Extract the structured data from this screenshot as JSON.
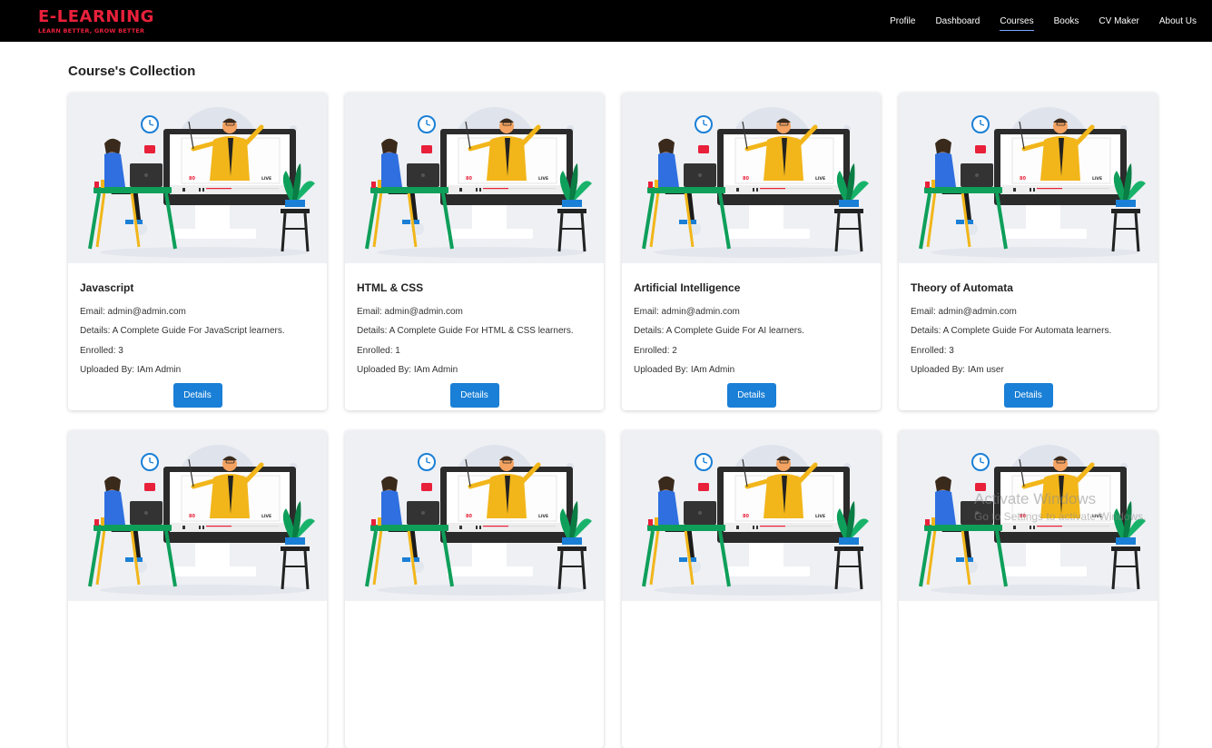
{
  "brand": {
    "title": "E-LEARNING",
    "tagline": "LEARN BETTER, GROW BETTER",
    "color": "#e8203a"
  },
  "nav": [
    {
      "label": "Profile",
      "active": false
    },
    {
      "label": "Dashboard",
      "active": false
    },
    {
      "label": "Courses",
      "active": true
    },
    {
      "label": "Books",
      "active": false
    },
    {
      "label": "CV Maker",
      "active": false
    },
    {
      "label": "About Us",
      "active": false
    }
  ],
  "page_title": "Course's Collection",
  "courses": [
    {
      "title": "Javascript",
      "email": "Email: admin@admin.com",
      "details": "Details: A Complete Guide For JavaScript learners.",
      "enrolled": "Enrolled: 3",
      "uploaded_by": "Uploaded By: IAm Admin",
      "button": "Details"
    },
    {
      "title": "HTML & CSS",
      "email": "Email: admin@admin.com",
      "details": "Details: A Complete Guide For HTML & CSS learners.",
      "enrolled": "Enrolled: 1",
      "uploaded_by": "Uploaded By: IAm Admin",
      "button": "Details"
    },
    {
      "title": "Artificial Intelligence",
      "email": "Email: admin@admin.com",
      "details": "Details: A Complete Guide For AI learners.",
      "enrolled": "Enrolled: 2",
      "uploaded_by": "Uploaded By: IAm Admin",
      "button": "Details"
    },
    {
      "title": "Theory of Automata",
      "email": "Email: admin@admin.com",
      "details": "Details: A Complete Guide For Automata learners.",
      "enrolled": "Enrolled: 3",
      "uploaded_by": "Uploaded By: IAm user",
      "button": "Details"
    }
  ],
  "illustration": {
    "badge_count": "80",
    "live_label": "LIVE"
  },
  "watermark": {
    "line1": "Activate Windows",
    "line2": "Go to Settings to activate Windows."
  },
  "colors": {
    "button": "#1a7fd6",
    "navbar": "#000000",
    "card_image_bg": "#eef0f4"
  }
}
